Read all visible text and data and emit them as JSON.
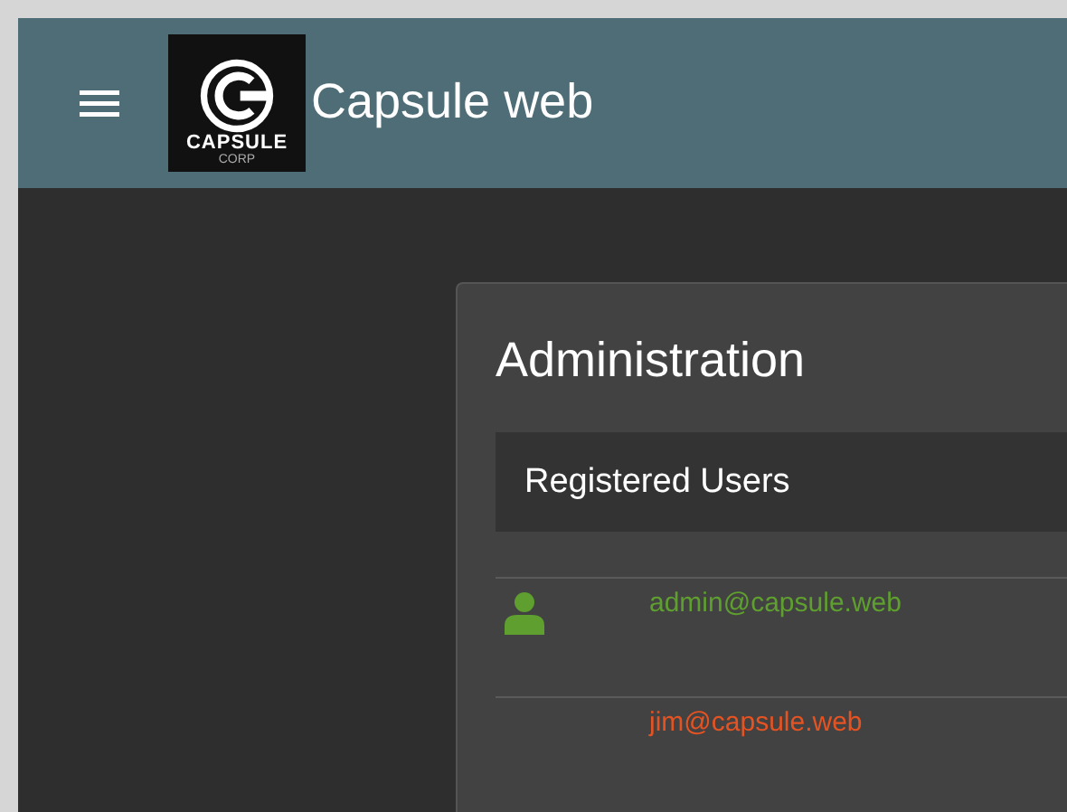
{
  "header": {
    "logo": {
      "word": "CAPSULE",
      "subword": "CORP"
    },
    "title": "Capsule web"
  },
  "card": {
    "title": "Administration",
    "section": "Registered Users",
    "users": [
      {
        "email": "admin@capsule.web",
        "color": "#5f9f2f",
        "has_icon": true
      },
      {
        "email": "jim@capsule.web",
        "color": "#e65322",
        "has_icon": false
      }
    ]
  }
}
